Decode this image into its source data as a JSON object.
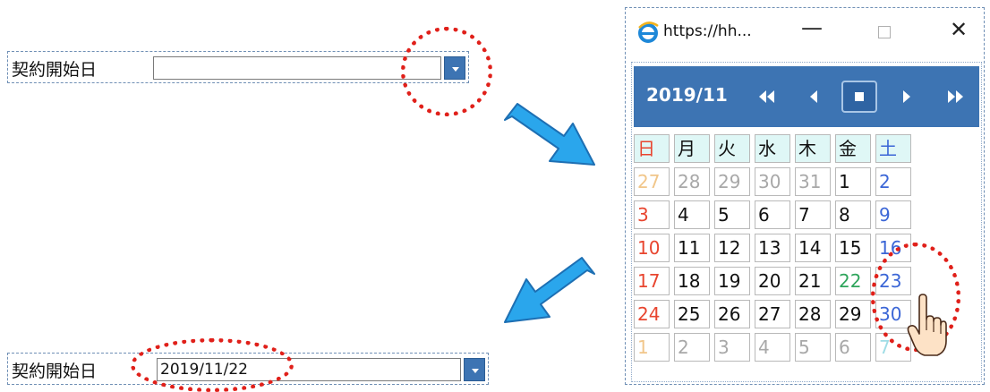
{
  "top_field": {
    "label": "契約開始日",
    "value": "",
    "button_icon": "dropdown-arrow-icon"
  },
  "bottom_field": {
    "label": "契約開始日",
    "value": "2019/11/22",
    "button_icon": "dropdown-arrow-icon"
  },
  "popup": {
    "title": "https://hh...",
    "window_controls": [
      "minimize-icon",
      "maximize-icon",
      "close-icon"
    ],
    "calendar": {
      "month_label": "2019/11",
      "nav_icons": [
        "prev-year-icon",
        "prev-month-icon",
        "today-icon",
        "next-month-icon",
        "next-year-icon"
      ],
      "weekdays": [
        "日",
        "月",
        "火",
        "水",
        "木",
        "金",
        "土"
      ],
      "weeks": [
        [
          "27",
          "28",
          "29",
          "30",
          "31",
          "1",
          "2"
        ],
        [
          "3",
          "4",
          "5",
          "6",
          "7",
          "8",
          "9"
        ],
        [
          "10",
          "11",
          "12",
          "13",
          "14",
          "15",
          "16"
        ],
        [
          "17",
          "18",
          "19",
          "20",
          "21",
          "22",
          "23"
        ],
        [
          "24",
          "25",
          "26",
          "27",
          "28",
          "29",
          "30"
        ],
        [
          "1",
          "2",
          "3",
          "4",
          "5",
          "6",
          "7"
        ]
      ],
      "selected_day": "22"
    }
  },
  "colors": {
    "accent": "#3d74b3",
    "highlight": "#e0201a",
    "arrow": "#2aa6ec",
    "sunday": "#e8452f",
    "saturday": "#3b66d6",
    "selected": "#2fa55c",
    "weekday_header_bg": "#dff7f6"
  }
}
